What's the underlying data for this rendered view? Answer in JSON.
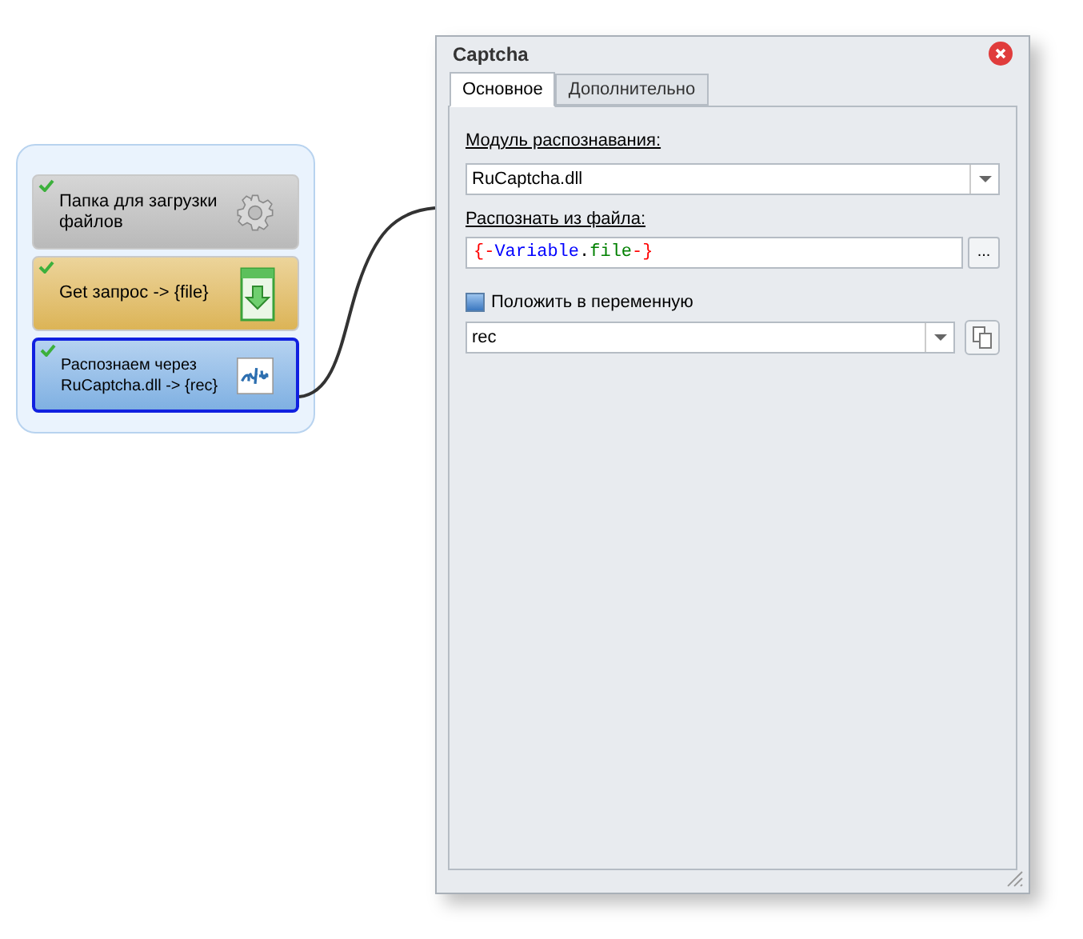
{
  "nodes": [
    {
      "kind": "settings",
      "label": "Папка для загрузки файлов",
      "checked": true,
      "selected": false
    },
    {
      "kind": "download",
      "label": "Get запрос -> {file}",
      "checked": true,
      "selected": false
    },
    {
      "kind": "captcha",
      "label": "Распознаем через RuCaptcha.dll -> {rec}",
      "checked": true,
      "selected": true
    }
  ],
  "dialog": {
    "title": "Captcha",
    "tabs": [
      {
        "label": "Основное",
        "selected": true
      },
      {
        "label": "Дополнительно",
        "selected": false
      }
    ],
    "module_label": "Модуль распознавания:",
    "module_value": "RuCaptcha.dll",
    "file_label": "Распознать из файла:",
    "file_tokens": [
      {
        "text": "{-",
        "color": "#ff0000"
      },
      {
        "text": "Variable",
        "color": "#0000ff"
      },
      {
        "text": ".",
        "color": "#000000"
      },
      {
        "text": "file",
        "color": "#008000"
      },
      {
        "text": "-}",
        "color": "#ff0000"
      }
    ],
    "browse_button": "...",
    "save_checkbox": {
      "label": "Положить в переменную",
      "checked": true
    },
    "variable_value": "rec"
  }
}
